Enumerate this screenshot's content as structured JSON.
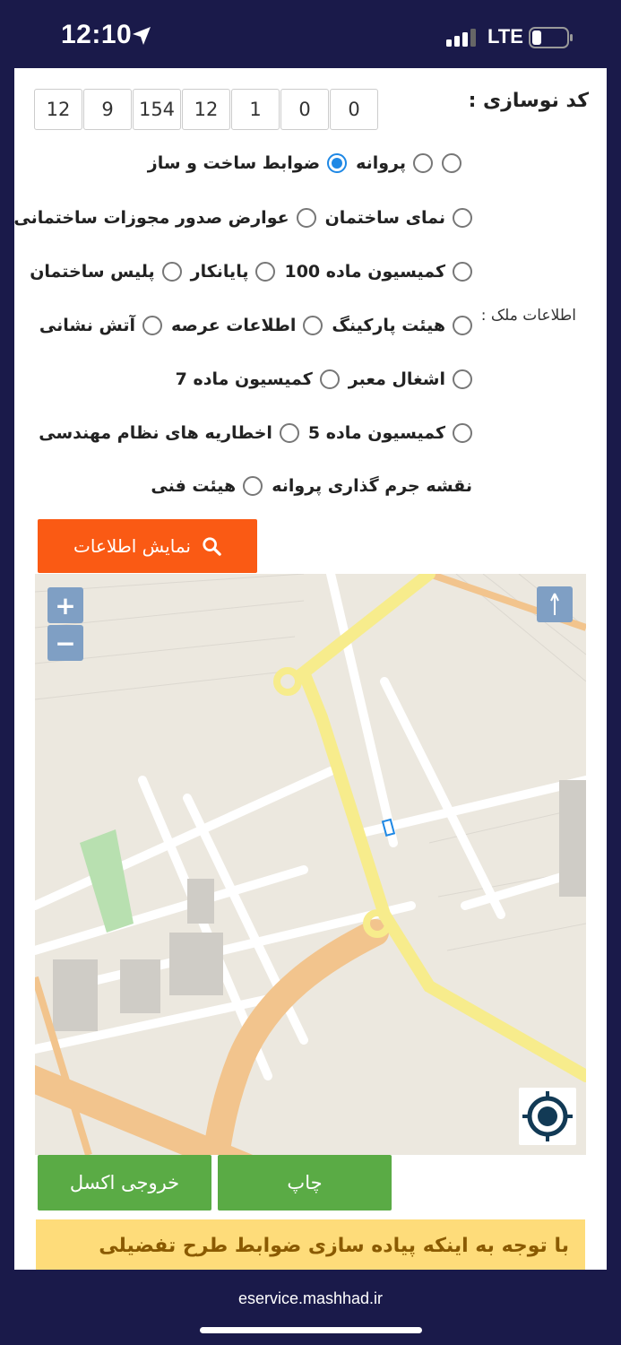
{
  "status": {
    "time": "12:10",
    "network": "LTE"
  },
  "form": {
    "nosazi_label": "کد نوسازی :",
    "code": [
      "12",
      "9",
      "154",
      "12",
      "1",
      "0",
      "0"
    ],
    "melk_label": "اطلاعات ملک :",
    "rows": [
      {
        "top": 0,
        "items": [
          {
            "label": "ضوابط ساخت و ساز",
            "checked": true
          },
          {
            "label": "پروانه",
            "checked": false
          },
          {
            "label": "",
            "checked": false
          }
        ]
      }
    ],
    "options": {
      "r1a": "ضوابط ساخت و ساز",
      "r1b": "پروانه",
      "r2a": "عوارض صدور مجوزات ساختمانی",
      "r2b": "نمای ساختمان",
      "r3a": "پلیس ساختمان",
      "r3b": "پایانکار",
      "r3c": "کمیسیون ماده 100",
      "r4a": "آتش نشانی",
      "r4b": "اطلاعات عرصه",
      "r4c": "هیئت پارکینگ",
      "r5a": "کمیسیون ماده 7",
      "r5b": "اشغال معبر",
      "r6a": "اخطاریه های نظام مهندسی",
      "r6b": "کمیسیون ماده 5",
      "r7a": "هیئت فنی",
      "r7b": "نقشه جرم گذاری پروانه"
    },
    "show_button": "نمایش اطلاعات"
  },
  "map": {
    "zoom_in": "+",
    "zoom_out": "−"
  },
  "actions": {
    "print": "چاپ",
    "excel": "خروجی اکسل"
  },
  "notice": "با توجه به اینکه پیاده سازی ضوابط طرح تفضیلی مصوب در",
  "browser": {
    "url": "eservice.mashhad.ir"
  },
  "colors": {
    "accent": "#fa5a14",
    "green": "#5aab45",
    "radio": "#1e88e5",
    "notice_bg": "#fedc7a"
  }
}
